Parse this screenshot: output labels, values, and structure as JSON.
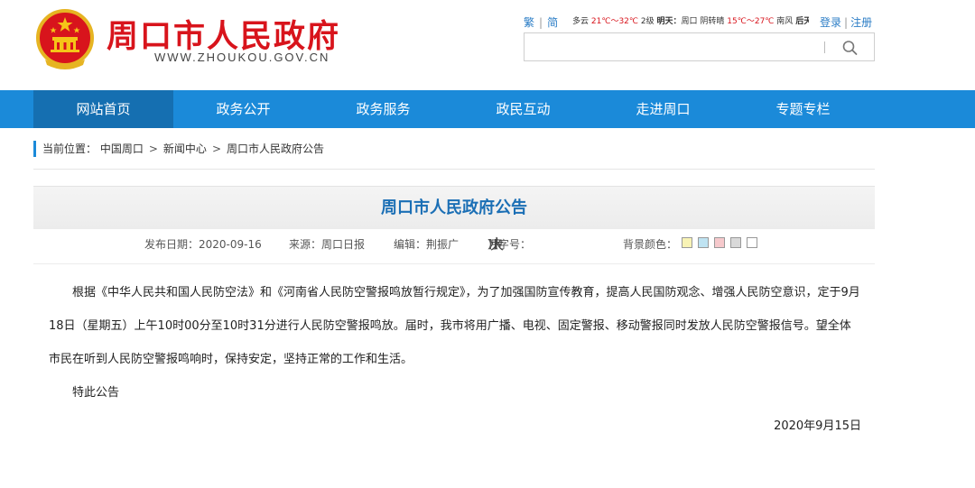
{
  "site": {
    "title": "周口市人民政府",
    "url": "WWW.ZHOUKOU.GOV.CN"
  },
  "topbar": {
    "lang_traditional": "繁",
    "lang_simplified": "简",
    "weather": {
      "today_head": "多云",
      "today_temp": "21℃～32℃",
      "today_wind": "2级",
      "tomorrow_label": "明天：",
      "tomorrow_city": "周口",
      "tomorrow_sky": "阴转晴",
      "tomorrow_temp": "15℃～27℃",
      "tomorrow_wind": "南风",
      "after_label": "后天"
    },
    "login": "登录",
    "register": "注册"
  },
  "search": {
    "value": "",
    "placeholder": ""
  },
  "nav": {
    "items": [
      {
        "label": "网站首页"
      },
      {
        "label": "政务公开"
      },
      {
        "label": "政务服务"
      },
      {
        "label": "政民互动"
      },
      {
        "label": "走进周口"
      },
      {
        "label": "专题专栏"
      }
    ]
  },
  "breadcrumb": {
    "prefix": "当前位置：",
    "items": [
      "中国周口",
      "新闻中心",
      "周口市人民政府公告"
    ],
    "arrow": ">"
  },
  "article": {
    "title": "周口市人民政府公告",
    "meta": {
      "date": "发布日期：2020-09-16",
      "source": "来源：周口日报",
      "editor": "编辑：荆振广",
      "font_label_open": "【字号：",
      "font_small": "小",
      "font_medium": "中",
      "font_large": "大",
      "font_label_close": "】",
      "bg_label": "背景颜色：",
      "bg_colors": [
        "#f8f3b5",
        "#bfe3f2",
        "#f6c9cc",
        "#d9d9d9",
        "#ffffff"
      ]
    },
    "paragraph": "根据《中华人民共和国人民防空法》和《河南省人民防空警报鸣放暂行规定》，为了加强国防宣传教育，提高人民国防观念、增强人民防空意识，定于9月18日（星期五）上午10时00分至10时31分进行人民防空警报鸣放。届时，我市将用广播、电视、固定警报、移动警报同时发放人民防空警报信号。望全体市民在听到人民防空警报鸣响时，保持安定，坚持正常的工作和生活。",
    "notice": "特此公告",
    "signed_date": "2020年9月15日"
  },
  "colors": {
    "brand_red": "#d8141c",
    "nav_blue": "#1b8ad9",
    "nav_active": "#156fb1",
    "title_blue": "#1b6fb5",
    "link_blue": "#2b7dc6"
  }
}
